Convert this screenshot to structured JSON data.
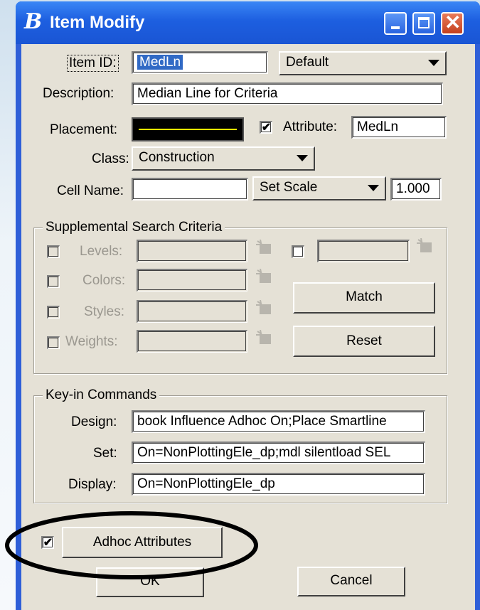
{
  "window": {
    "title": "Item Modify"
  },
  "item_id": {
    "label": "Item ID:",
    "value": "MedLn",
    "combo": "Default"
  },
  "description": {
    "label": "Description:",
    "value": "Median Line for Criteria"
  },
  "placement": {
    "label": "Placement:"
  },
  "attribute": {
    "label": "Attribute:",
    "value": "MedLn",
    "checked": true
  },
  "class": {
    "label": "Class:",
    "value": "Construction"
  },
  "cell": {
    "label": "Cell Name:",
    "value": "",
    "scale_combo": "Set Scale",
    "scale_value": "1.000"
  },
  "supplemental": {
    "title": "Supplemental Search Criteria",
    "levels": "Levels:",
    "colors": "Colors:",
    "styles": "Styles:",
    "weights": "Weights:",
    "match": "Match",
    "reset": "Reset"
  },
  "keyin": {
    "title": "Key-in Commands",
    "design_label": "Design:",
    "design_value": "book Influence Adhoc On;Place Smartline",
    "set_label": "Set:",
    "set_value": "On=NonPlottingEle_dp;mdl silentload SEL",
    "display_label": "Display:",
    "display_value": "On=NonPlottingEle_dp"
  },
  "adhoc": {
    "label": "Adhoc Attributes",
    "checked": true
  },
  "footer": {
    "ok": "OK",
    "cancel": "Cancel"
  },
  "colors": {
    "titlebar": "#1d5fe0",
    "client": "#e5e1d6",
    "highlight_circle": "#000000"
  }
}
